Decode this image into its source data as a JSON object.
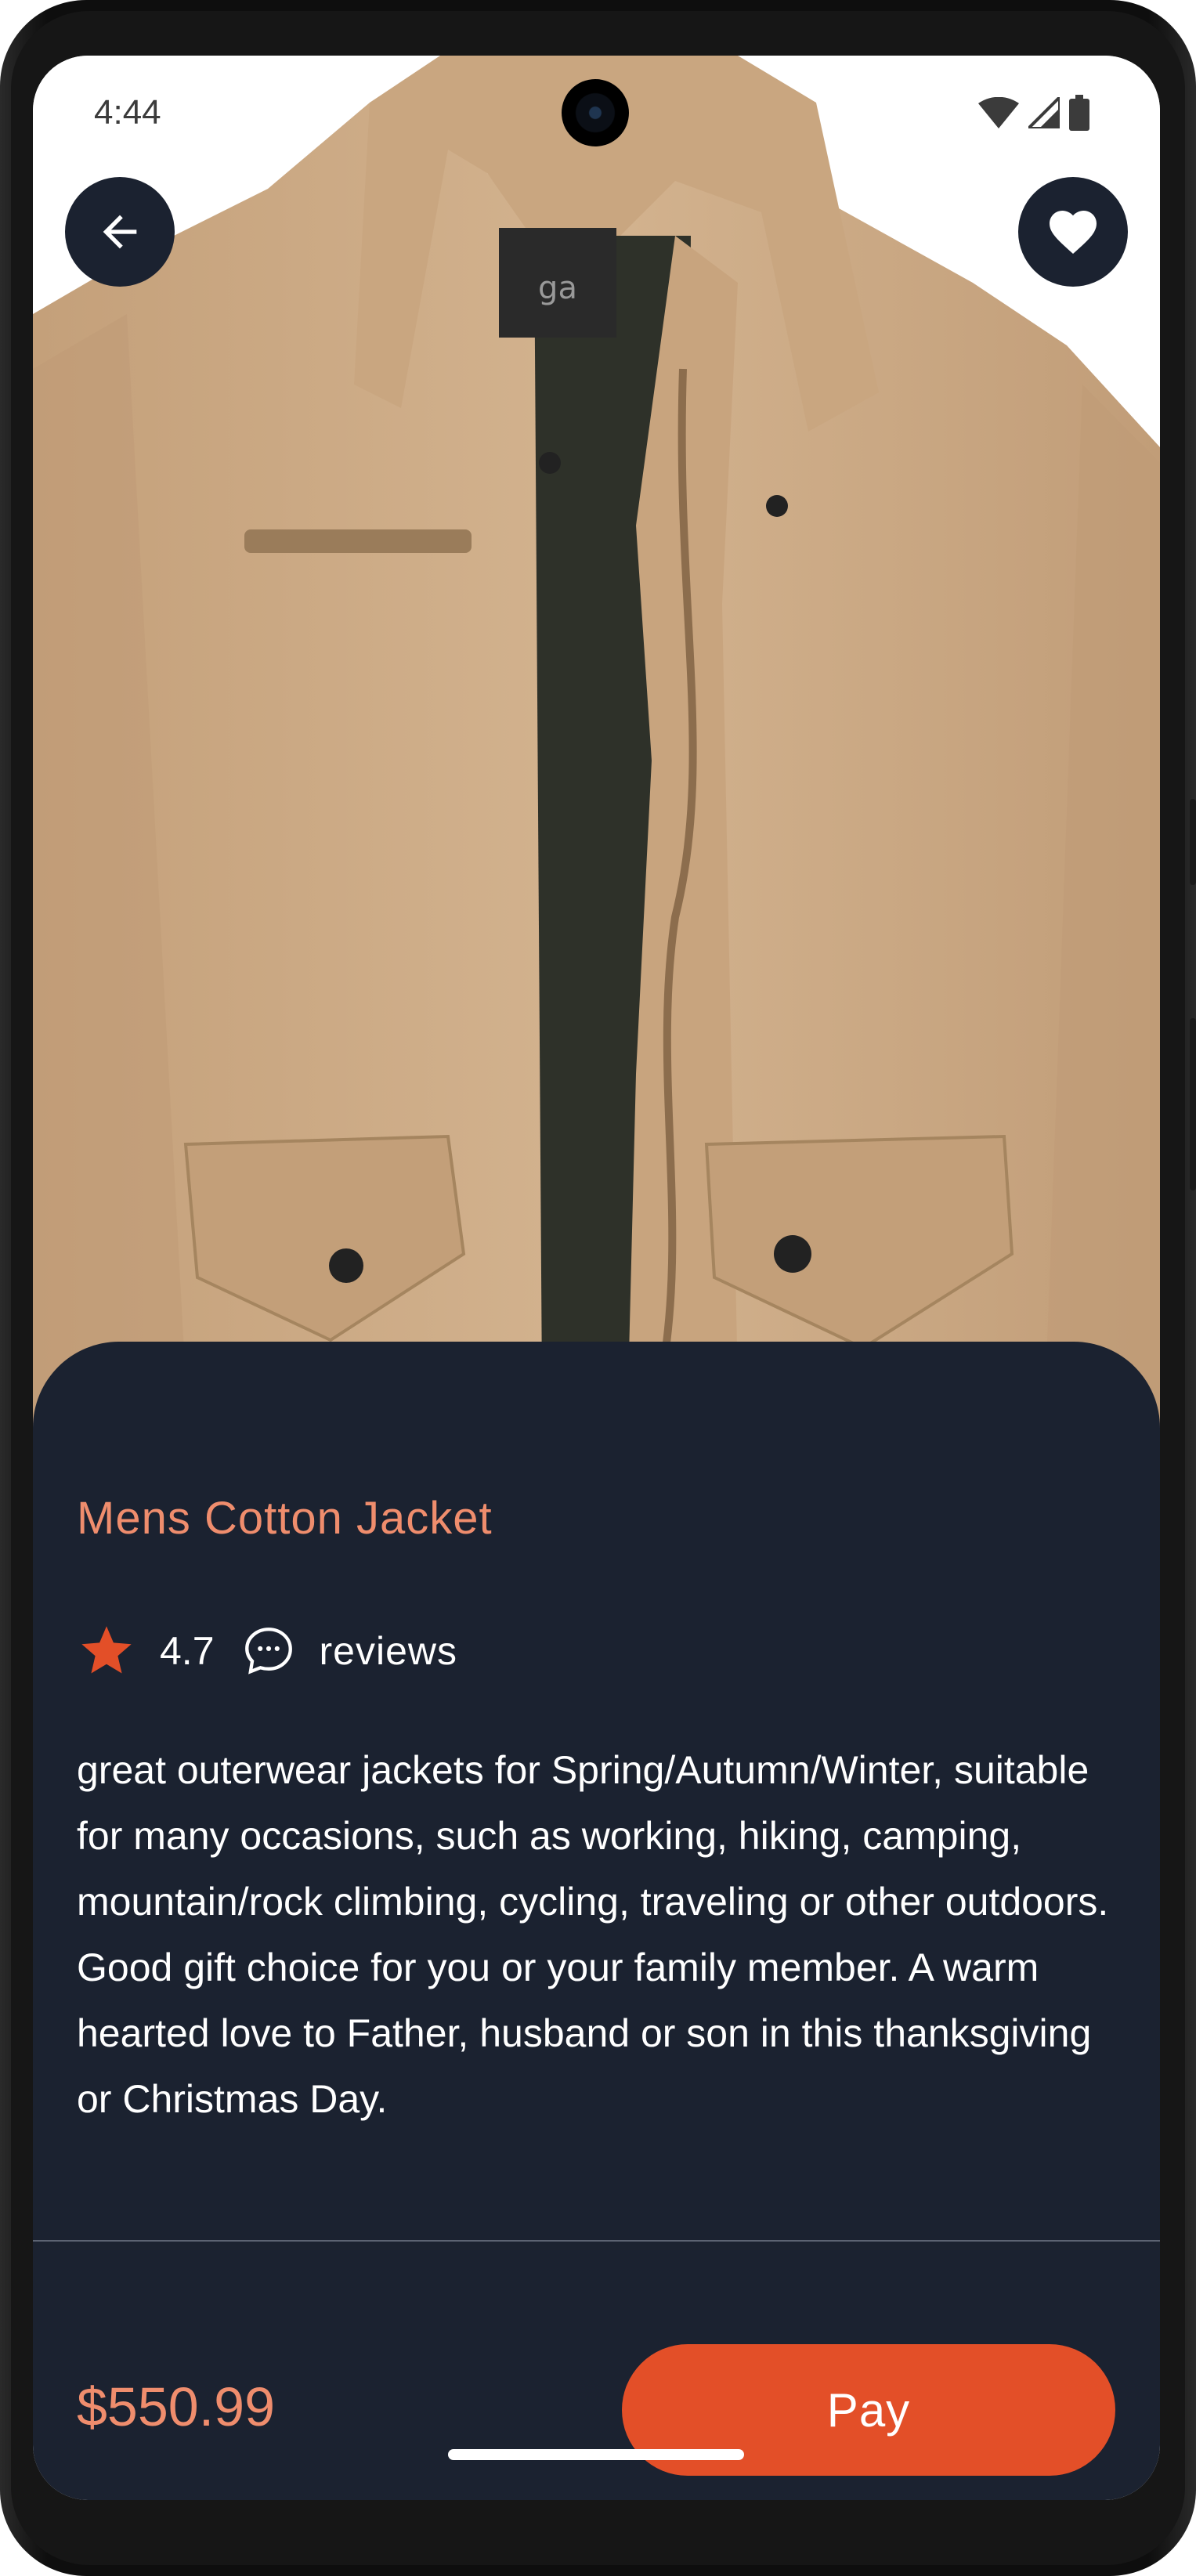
{
  "status_bar": {
    "time": "4:44"
  },
  "product": {
    "title": "Mens Cotton Jacket",
    "rating": "4.7",
    "reviews_label": "reviews",
    "description": "great outerwear jackets for Spring/Autumn/Winter, suitable for many occasions, such as working, hiking, camping, mountain/rock climbing, cycling, traveling or other outdoors. Good gift choice for you or your family member. A warm hearted love to Father, husband or son in this thanksgiving or Christmas Day.",
    "price": "$550.99",
    "image_label": "ga"
  },
  "actions": {
    "pay_label": "Pay"
  },
  "icons": {
    "back": "arrow-left-icon",
    "favorite": "heart-icon",
    "star": "star-icon",
    "reviews": "chat-bubble-icon"
  },
  "colors": {
    "accent": "#e34f28",
    "title": "#ef8d6d",
    "sheet_bg": "#1b2230",
    "star": "#e34f28",
    "jacket": "#cfae88"
  }
}
